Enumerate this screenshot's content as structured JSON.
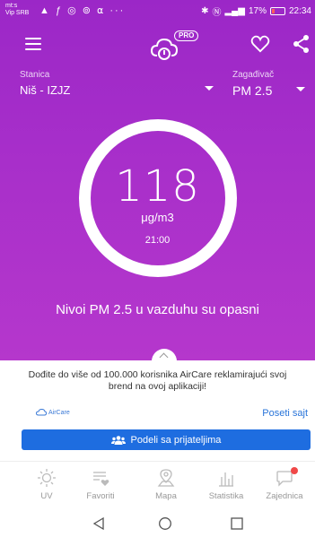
{
  "statusbar": {
    "carrier_line1": "mt:s",
    "carrier_line2": "Vip SRB",
    "battery": "17%",
    "time": "22:34"
  },
  "header": {
    "badge": "PRO"
  },
  "station": {
    "label": "Stanica",
    "value": "Niš - IZJZ"
  },
  "pollutant": {
    "label": "Zagađivač",
    "value": "PM 2.5"
  },
  "reading": {
    "value": "118",
    "unit": "μg/m3",
    "time": "21:00",
    "status": "Nivoi PM 2.5 u vazduhu su opasni"
  },
  "promo": {
    "text": "Dođite do više od 100.000 korisnika AirCare reklamirajući svoj brend na ovoj aplikaciji!",
    "brand": "AirCare",
    "link": "Poseti sajt",
    "share_button": "Podeli sa prijateljima"
  },
  "tabs": [
    {
      "label": "UV",
      "icon": "sun-icon"
    },
    {
      "label": "Favoriti",
      "icon": "favorites-icon"
    },
    {
      "label": "Mapa",
      "icon": "map-icon"
    },
    {
      "label": "Statistika",
      "icon": "stats-icon"
    },
    {
      "label": "Zajednica",
      "icon": "community-icon"
    }
  ],
  "colors": {
    "hero": "#a82fca",
    "accent_blue": "#1e6de0",
    "notification_dot": "#f04848"
  }
}
